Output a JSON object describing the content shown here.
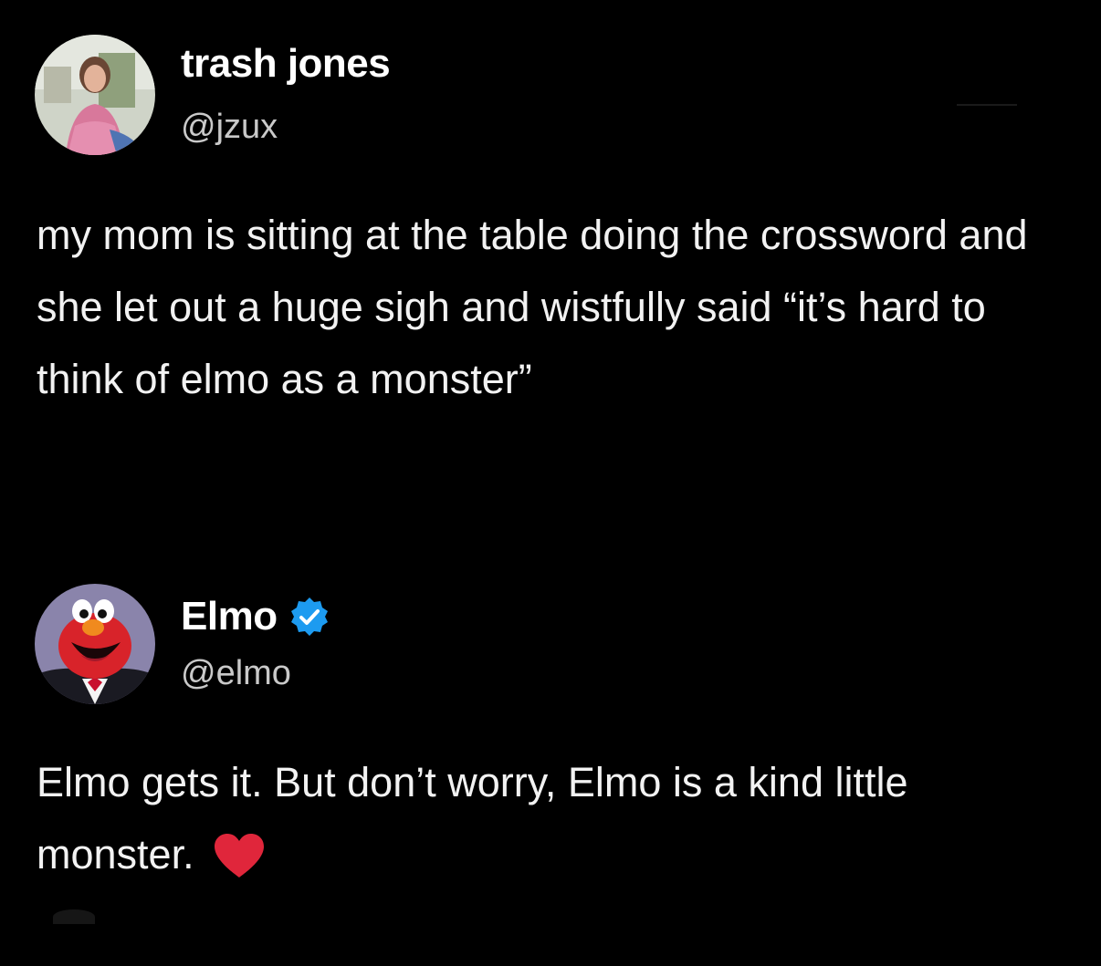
{
  "tweets": [
    {
      "display_name": "trash jones",
      "handle": "@jzux",
      "verified": false,
      "text": "my mom is sitting at the table doing the crossword and she let out a huge sigh and wistfully said “it’s hard to think of elmo as a monster”"
    },
    {
      "display_name": "Elmo",
      "handle": "@elmo",
      "verified": true,
      "text": "Elmo gets it. But don’t worry, Elmo is a kind little monster.",
      "emoji": "red-heart-icon"
    }
  ],
  "colors": {
    "background": "#000000",
    "text": "#f2f2f2",
    "handle": "#c9c9c9",
    "verified_badge": "#1d9bf0",
    "heart": "#e0263b"
  }
}
